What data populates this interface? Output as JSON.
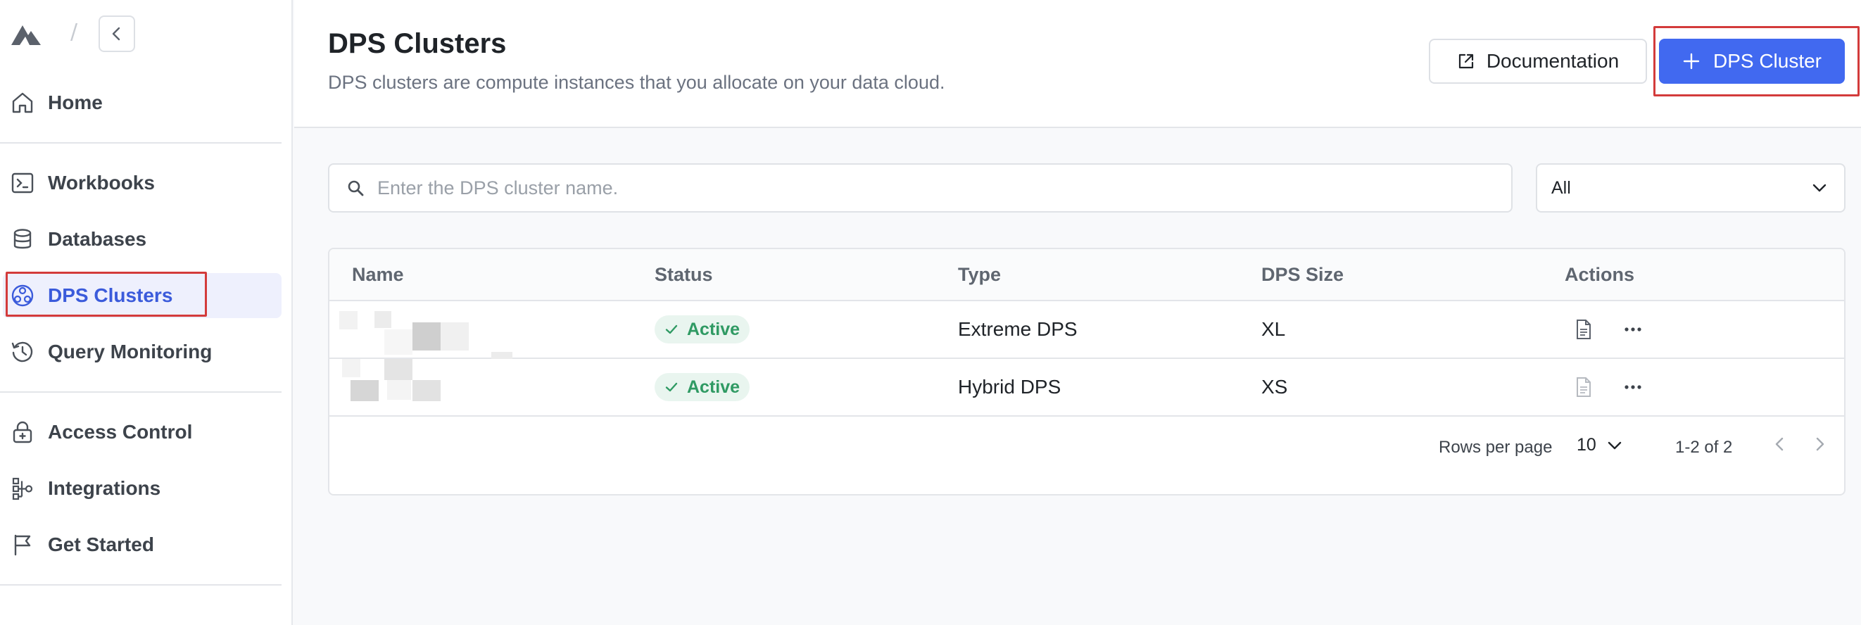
{
  "sidebar": {
    "items": [
      {
        "label": "Home",
        "icon": "home-icon"
      },
      {
        "label": "Workbooks",
        "icon": "terminal-icon"
      },
      {
        "label": "Databases",
        "icon": "database-icon"
      },
      {
        "label": "DPS Clusters",
        "icon": "cluster-icon"
      },
      {
        "label": "Query Monitoring",
        "icon": "history-icon"
      },
      {
        "label": "Access Control",
        "icon": "lock-icon"
      },
      {
        "label": "Integrations",
        "icon": "integrations-icon"
      },
      {
        "label": "Get Started",
        "icon": "flag-icon"
      }
    ],
    "active": "DPS Clusters",
    "breadcrumb_separator": "/"
  },
  "header": {
    "title": "DPS Clusters",
    "subtitle": "DPS clusters are compute instances that you allocate on your data cloud.",
    "documentation_label": "Documentation",
    "add_cluster_label": "DPS Cluster"
  },
  "filters": {
    "search_placeholder": "Enter the DPS cluster name.",
    "select_value": "All"
  },
  "table": {
    "columns": [
      "Name",
      "Status",
      "Type",
      "DPS Size",
      "Actions"
    ],
    "rows": [
      {
        "status": "Active",
        "type": "Extreme DPS",
        "size": "XL"
      },
      {
        "status": "Active",
        "type": "Hybrid DPS",
        "size": "XS"
      }
    ]
  },
  "pagination": {
    "rows_per_page_label": "Rows per page",
    "rows_per_page": "10",
    "range": "1-2 of 2"
  },
  "colors": {
    "accent": "#4169f0",
    "active_nav": "#3b5bdb",
    "status_active": "#2f9a63",
    "highlight": "#d33b3b"
  }
}
